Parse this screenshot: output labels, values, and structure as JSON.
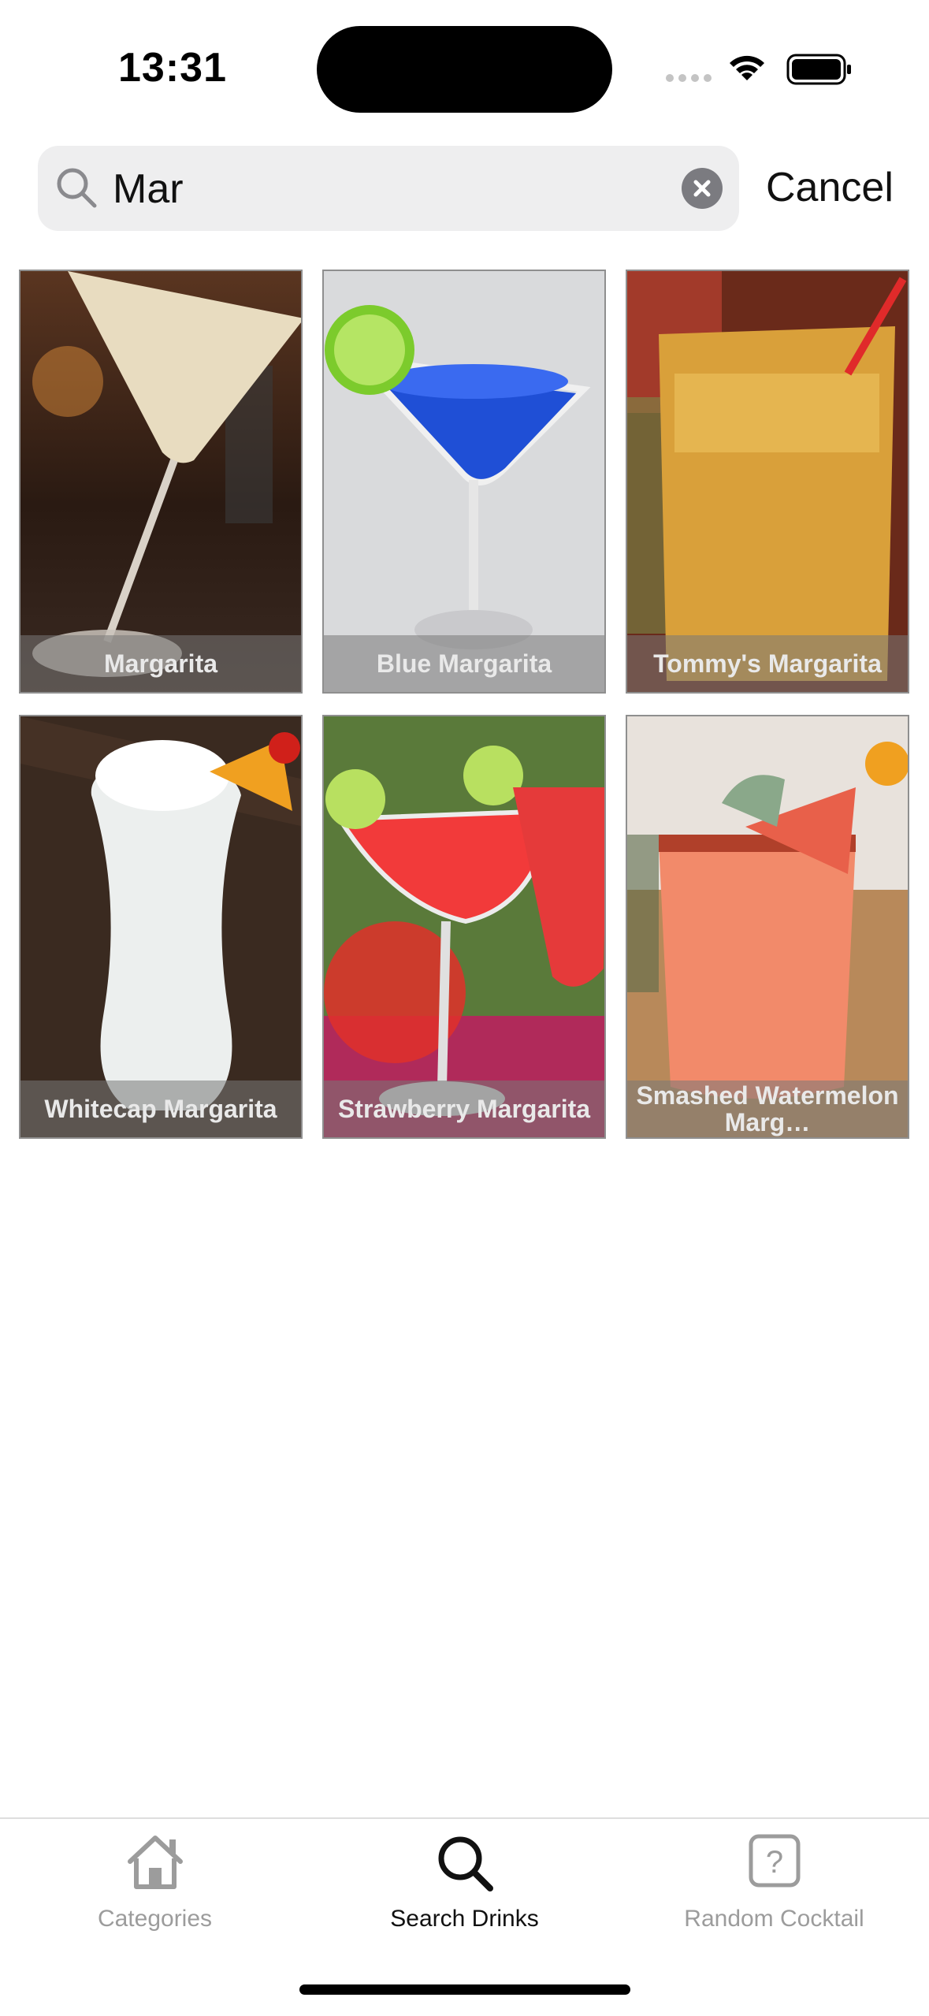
{
  "status_bar": {
    "time": "13:31"
  },
  "search": {
    "value": "Mar",
    "placeholder": "",
    "cancel_label": "Cancel",
    "icon": "magnifying-glass",
    "clear_icon": "xmark-circle-fill"
  },
  "results": [
    {
      "name": "Margarita"
    },
    {
      "name": "Blue Margarita"
    },
    {
      "name": "Tommy's Margarita"
    },
    {
      "name": "Whitecap Margarita"
    },
    {
      "name": "Strawberry Margarita"
    },
    {
      "name": "Smashed Watermelon Marg…"
    }
  ],
  "tabs": [
    {
      "label": "Categories",
      "icon": "house",
      "active": false
    },
    {
      "label": "Search Drinks",
      "icon": "magnifying-glass",
      "active": true
    },
    {
      "label": "Random Cocktail",
      "icon": "questionmark-square",
      "active": false
    }
  ],
  "colors": {
    "active_tab": "#111111",
    "inactive_tab": "#9c9c9c",
    "search_field_bg": "#eeeeef"
  }
}
